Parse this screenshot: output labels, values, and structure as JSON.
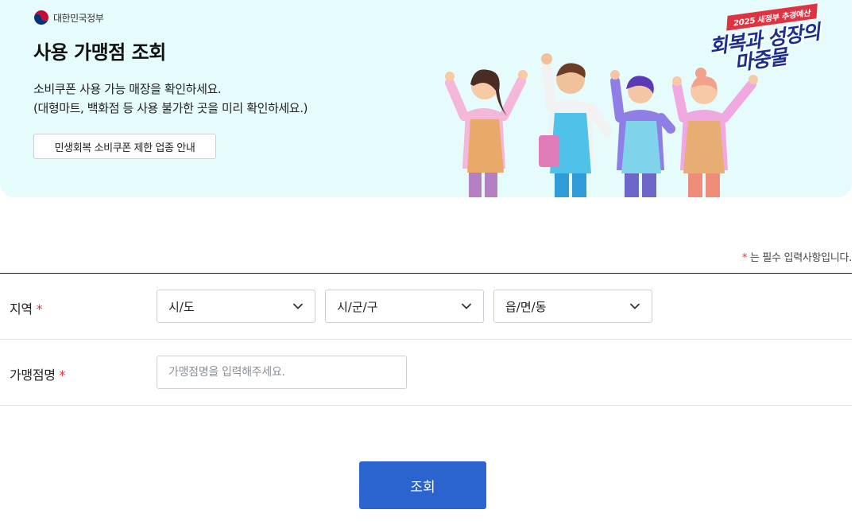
{
  "banner": {
    "gov_name": "대한민국정부",
    "title": "사용 가맹점 조회",
    "desc_line1": "소비쿠폰 사용 가능 매장을 확인하세요.",
    "desc_line2": "(대형마트, 백화점 등 사용 불가한 곳을 미리 확인하세요.)",
    "info_button_label": "민생회복 소비쿠폰 제한 업종 안내",
    "campaign_tag": "2025 새정부 추경예산",
    "campaign_line1": "회복과 성장의",
    "campaign_line2": "마중물"
  },
  "form": {
    "required_note_star": "*",
    "required_note_text": " 는 필수 입력사항입니다.",
    "region": {
      "label": "지역",
      "required": "*",
      "sido": "시/도",
      "sigungu": "시/군/구",
      "dong": "읍/면/동"
    },
    "store": {
      "label": "가맹점명",
      "required": "*",
      "placeholder": "가맹점명을 입력해주세요."
    },
    "search_button": "조회"
  },
  "colors": {
    "banner_bg": "#e6fbfc",
    "primary": "#2b63cf",
    "required_star": "#e0303c",
    "campaign_blue": "#1d2f8c",
    "campaign_red": "#e03241"
  }
}
